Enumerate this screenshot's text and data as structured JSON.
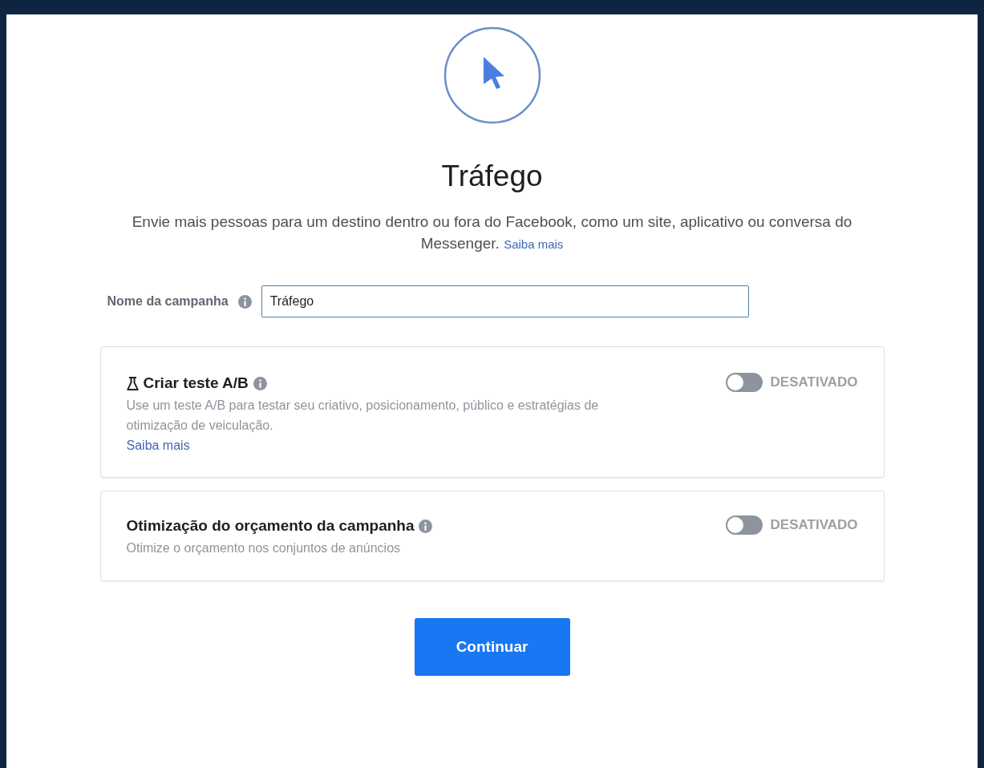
{
  "title": "Tráfego",
  "description": "Envie mais pessoas para um destino dentro ou fora do Facebook, como um site, aplicativo ou conversa do Messenger.",
  "description_link": "Saiba mais",
  "campaign_name": {
    "label": "Nome da campanha",
    "value": "Tráfego"
  },
  "cards": [
    {
      "kind": "test",
      "title": "Criar teste A/B",
      "description": "Use um teste A/B para testar seu criativo, posicionamento, público e estratégias de otimização de veiculação.",
      "link": "Saiba mais",
      "toggle": {
        "on": false,
        "label": "DESATIVADO"
      }
    },
    {
      "kind": "plain",
      "title": "Otimização do orçamento da campanha",
      "description": "Otimize o orçamento nos conjuntos de anúncios",
      "toggle": {
        "on": false,
        "label": "DESATIVADO"
      }
    }
  ],
  "button": "Continuar"
}
